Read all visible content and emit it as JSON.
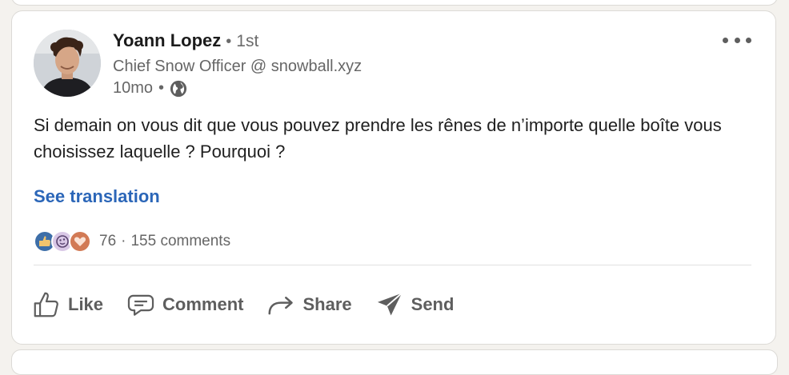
{
  "post": {
    "author": {
      "name": "Yoann Lopez",
      "separator": "•",
      "degree": "1st",
      "headline": "Chief Snow Officer @ snowball.xyz",
      "time": "10mo",
      "time_separator": "•"
    },
    "text": "Si demain on vous dit que vous pouvez prendre les rênes de n’importe quelle boîte vous choisissez laquelle ? Pourquoi ?",
    "see_translation": "See translation",
    "reactions": {
      "icons": [
        "like-icon",
        "insightful-icon",
        "love-icon"
      ],
      "count": "76",
      "separator": "·",
      "comments": "155 comments"
    },
    "actions": {
      "like": "Like",
      "comment": "Comment",
      "share": "Share",
      "send": "Send"
    }
  },
  "colors": {
    "link": "#2b66b8",
    "like": "#3d6ea8",
    "insightful": "#d9c8e6",
    "love": "#d27a55"
  }
}
